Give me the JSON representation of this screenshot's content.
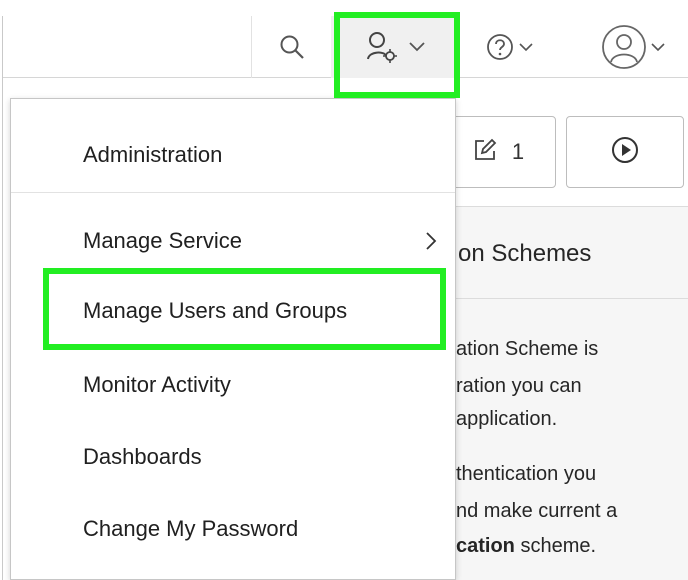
{
  "header": {
    "search_icon": "search-icon",
    "admin_icon": "administration-user-gear-icon",
    "help_icon": "help-question-icon",
    "user_icon": "user-avatar-icon"
  },
  "toolbar": {
    "edit_count": "1",
    "edit_icon": "edit-pencil-icon",
    "run_icon": "play-run-icon"
  },
  "admin_menu": {
    "items": [
      {
        "label": "Administration"
      },
      {
        "label": "Manage Service",
        "has_submenu": true
      },
      {
        "label": "Manage Users and Groups",
        "highlighted": true
      },
      {
        "label": "Monitor Activity"
      },
      {
        "label": "Dashboards"
      },
      {
        "label": "Change My Password"
      }
    ]
  },
  "region": {
    "title": "on Schemes",
    "lines": [
      "ation Scheme is",
      "ration you can",
      "application.",
      "thentication you",
      "nd make current a"
    ],
    "last_line_bold": "cation",
    "last_line_rest": " scheme."
  },
  "colors": {
    "highlight": "#22ee22",
    "region_bg": "#f6f6f6",
    "header_active_bg": "#f0f0f0"
  }
}
